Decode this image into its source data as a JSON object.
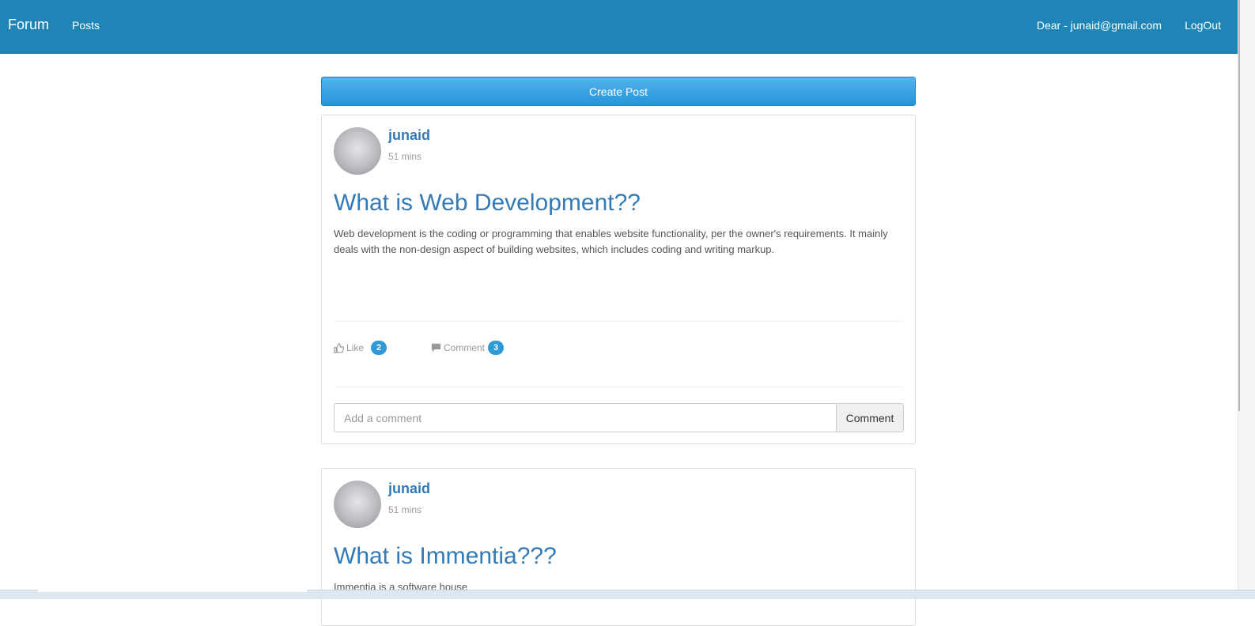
{
  "navbar": {
    "brand": "Forum",
    "posts_link": "Posts",
    "user_greeting": "Dear - junaid@gmail.com",
    "logout": "LogOut",
    "background_color": "#1f84b6"
  },
  "create_post_label": "Create Post",
  "posts": [
    {
      "author": "junaid",
      "time": "51 mins",
      "title": "What is Web Development??",
      "body": "Web development is the coding or programming that enables website functionality, per the owner's requirements. It mainly deals with the non-design aspect of building websites, which includes coding and writing markup.",
      "like_label": "Like",
      "like_count": "2",
      "comment_label": "Comment",
      "comment_count": "3",
      "comment_placeholder": "Add a comment",
      "comment_button": "Comment"
    },
    {
      "author": "junaid",
      "time": "51 mins",
      "title": "What is Immentia???",
      "body": "Immentia is a software house"
    }
  ],
  "icons": {
    "like": "thumbs-up-icon",
    "comment": "comment-icon"
  },
  "colors": {
    "link_blue": "#337ab7",
    "badge_blue": "#2d9ad8",
    "create_button": "#2394d9"
  }
}
